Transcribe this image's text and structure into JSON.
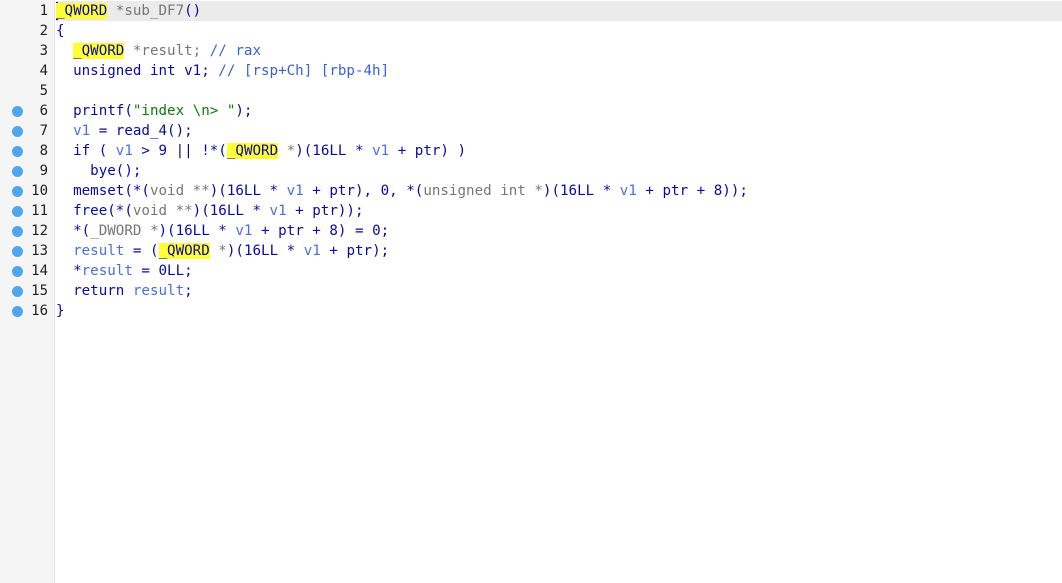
{
  "editor": {
    "lines": [
      {
        "n": "1",
        "breakpoint": false,
        "current": true,
        "tokens": [
          {
            "t": "_QWORD",
            "c": "type"
          },
          {
            "t": " *sub_DF7",
            "c": "gray"
          },
          {
            "t": "()",
            "c": "id"
          }
        ]
      },
      {
        "n": "2",
        "breakpoint": false,
        "tokens": [
          {
            "t": "{",
            "c": "id"
          }
        ]
      },
      {
        "n": "3",
        "breakpoint": false,
        "tokens": [
          {
            "t": "  ",
            "c": "id"
          },
          {
            "t": "_QWORD",
            "c": "type"
          },
          {
            "t": " *result; ",
            "c": "gray"
          },
          {
            "t": "// rax",
            "c": "cmt"
          }
        ]
      },
      {
        "n": "4",
        "breakpoint": false,
        "tokens": [
          {
            "t": "  unsigned int v1; ",
            "c": "id"
          },
          {
            "t": "// [rsp+Ch] [rbp-4h]",
            "c": "cmt"
          }
        ]
      },
      {
        "n": "5",
        "breakpoint": false,
        "tokens": []
      },
      {
        "n": "6",
        "breakpoint": true,
        "tokens": [
          {
            "t": "  printf(",
            "c": "id"
          },
          {
            "t": "\"index \\n> \"",
            "c": "str"
          },
          {
            "t": ");",
            "c": "id"
          }
        ]
      },
      {
        "n": "7",
        "breakpoint": true,
        "tokens": [
          {
            "t": "  ",
            "c": "id"
          },
          {
            "t": "v1",
            "c": "var"
          },
          {
            "t": " = read_4();",
            "c": "id"
          }
        ]
      },
      {
        "n": "8",
        "breakpoint": true,
        "tokens": [
          {
            "t": "  if ( ",
            "c": "id"
          },
          {
            "t": "v1",
            "c": "var"
          },
          {
            "t": " > 9 || !*(",
            "c": "id"
          },
          {
            "t": "_QWORD",
            "c": "type"
          },
          {
            "t": " *",
            "c": "gray"
          },
          {
            "t": ")(16LL * ",
            "c": "id"
          },
          {
            "t": "v1",
            "c": "var"
          },
          {
            "t": " + ptr) )",
            "c": "id"
          }
        ]
      },
      {
        "n": "9",
        "breakpoint": true,
        "tokens": [
          {
            "t": "    bye();",
            "c": "id"
          }
        ]
      },
      {
        "n": "10",
        "breakpoint": true,
        "tokens": [
          {
            "t": "  memset(*(",
            "c": "id"
          },
          {
            "t": "void **",
            "c": "gray"
          },
          {
            "t": ")(16LL * ",
            "c": "id"
          },
          {
            "t": "v1",
            "c": "var"
          },
          {
            "t": " + ptr), 0, *(",
            "c": "id"
          },
          {
            "t": "unsigned int *",
            "c": "gray"
          },
          {
            "t": ")(16LL * ",
            "c": "id"
          },
          {
            "t": "v1",
            "c": "var"
          },
          {
            "t": " + ptr + 8));",
            "c": "id"
          }
        ]
      },
      {
        "n": "11",
        "breakpoint": true,
        "tokens": [
          {
            "t": "  free(*(",
            "c": "id"
          },
          {
            "t": "void **",
            "c": "gray"
          },
          {
            "t": ")(16LL * ",
            "c": "id"
          },
          {
            "t": "v1",
            "c": "var"
          },
          {
            "t": " + ptr));",
            "c": "id"
          }
        ]
      },
      {
        "n": "12",
        "breakpoint": true,
        "tokens": [
          {
            "t": "  *(",
            "c": "id"
          },
          {
            "t": "_DWORD *",
            "c": "gray"
          },
          {
            "t": ")(16LL * ",
            "c": "id"
          },
          {
            "t": "v1",
            "c": "var"
          },
          {
            "t": " + ptr + 8) = 0;",
            "c": "id"
          }
        ]
      },
      {
        "n": "13",
        "breakpoint": true,
        "tokens": [
          {
            "t": "  ",
            "c": "id"
          },
          {
            "t": "result",
            "c": "var"
          },
          {
            "t": " = (",
            "c": "id"
          },
          {
            "t": "_QWORD",
            "c": "type"
          },
          {
            "t": " *",
            "c": "gray"
          },
          {
            "t": ")(16LL * ",
            "c": "id"
          },
          {
            "t": "v1",
            "c": "var"
          },
          {
            "t": " + ptr);",
            "c": "id"
          }
        ]
      },
      {
        "n": "14",
        "breakpoint": true,
        "tokens": [
          {
            "t": "  *",
            "c": "id"
          },
          {
            "t": "result",
            "c": "var"
          },
          {
            "t": " = 0LL;",
            "c": "id"
          }
        ]
      },
      {
        "n": "15",
        "breakpoint": true,
        "tokens": [
          {
            "t": "  return ",
            "c": "id"
          },
          {
            "t": "result",
            "c": "var"
          },
          {
            "t": ";",
            "c": "id"
          }
        ]
      },
      {
        "n": "16",
        "breakpoint": true,
        "tokens": [
          {
            "t": "}",
            "c": "id"
          }
        ]
      }
    ]
  },
  "colors": {
    "type_highlight": "#ffff33",
    "identifier": "#0a0aa0",
    "variable": "#4a6fd8",
    "comment": "#3d5fd6",
    "string": "#0b7a0b",
    "breakpoint": "#4ea7ee"
  },
  "icons": {
    "breakpoint": "breakpoint-dot-icon"
  }
}
